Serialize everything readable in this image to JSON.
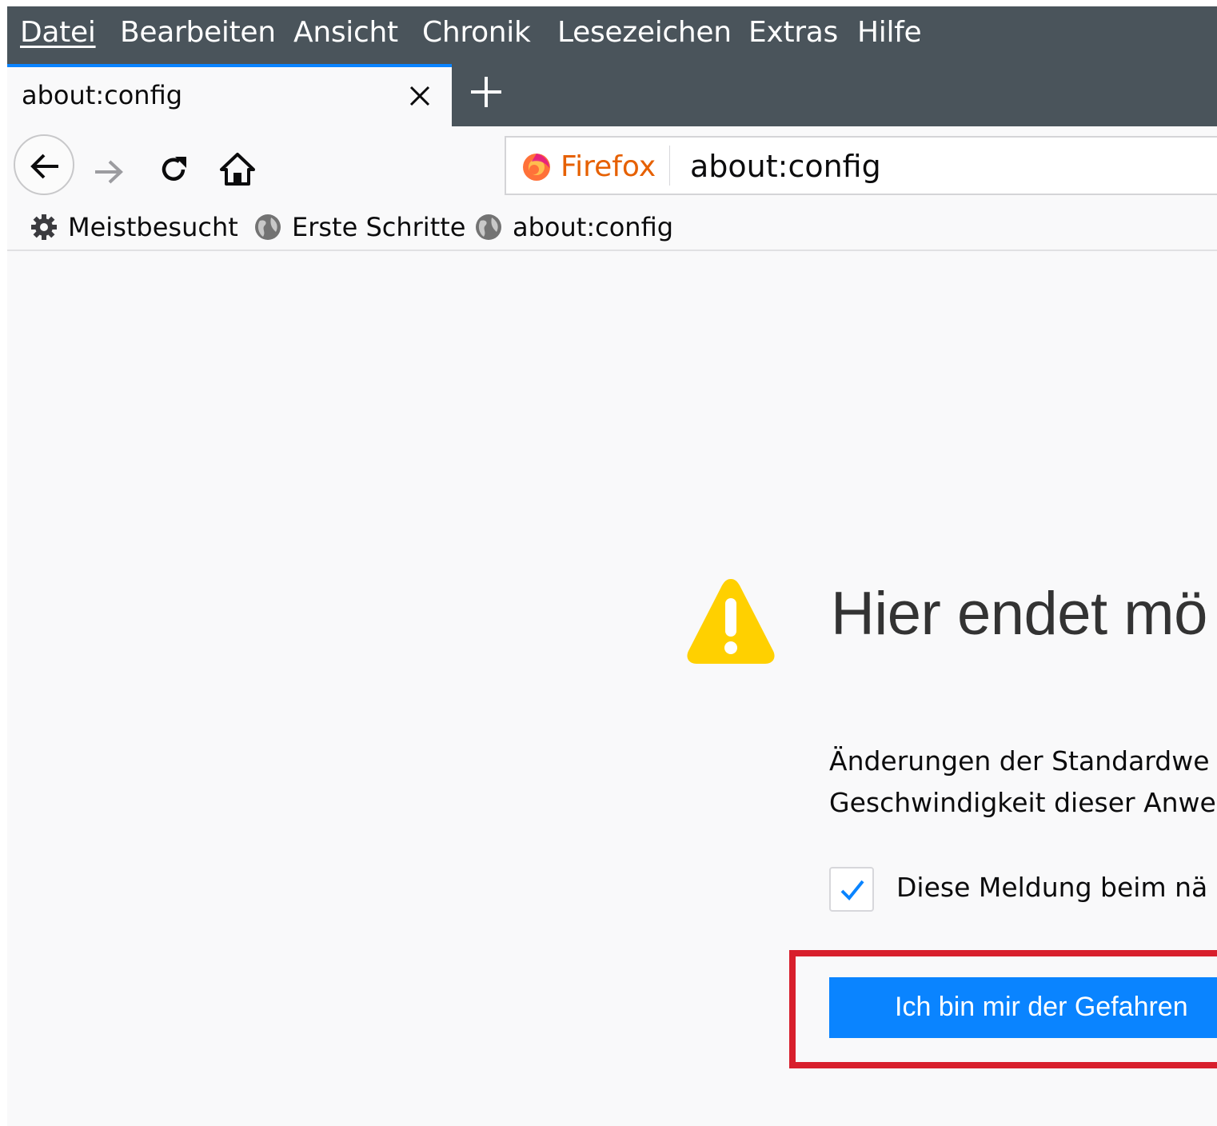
{
  "menubar": {
    "items": [
      "Datei",
      "Bearbeiten",
      "Ansicht",
      "Chronik",
      "Lesezeichen",
      "Extras",
      "Hilfe"
    ]
  },
  "tabs": [
    {
      "title": "about:config",
      "active": true
    }
  ],
  "navbar": {
    "identity_label": "Firefox",
    "url": "about:config"
  },
  "bookmarks": [
    {
      "label": "Meistbesucht",
      "icon": "gear-icon"
    },
    {
      "label": "Erste Schritte",
      "icon": "globe-icon"
    },
    {
      "label": "about:config",
      "icon": "globe-icon"
    }
  ],
  "warning": {
    "title": "Hier endet mö",
    "text_lines": [
      "Änderungen der Standardwe",
      "Geschwindigkeit dieser Anwe"
    ],
    "checkbox_checked": true,
    "checkbox_label": "Diese Meldung beim nä",
    "accept_button": "Ich bin mir der Gefahren"
  },
  "colors": {
    "chrome_dark": "#4a545b",
    "accent_blue": "#0a84ff",
    "highlight_red": "#d81f2c",
    "warning_yellow": "#ffd000",
    "firefox_orange": "#e66000"
  }
}
